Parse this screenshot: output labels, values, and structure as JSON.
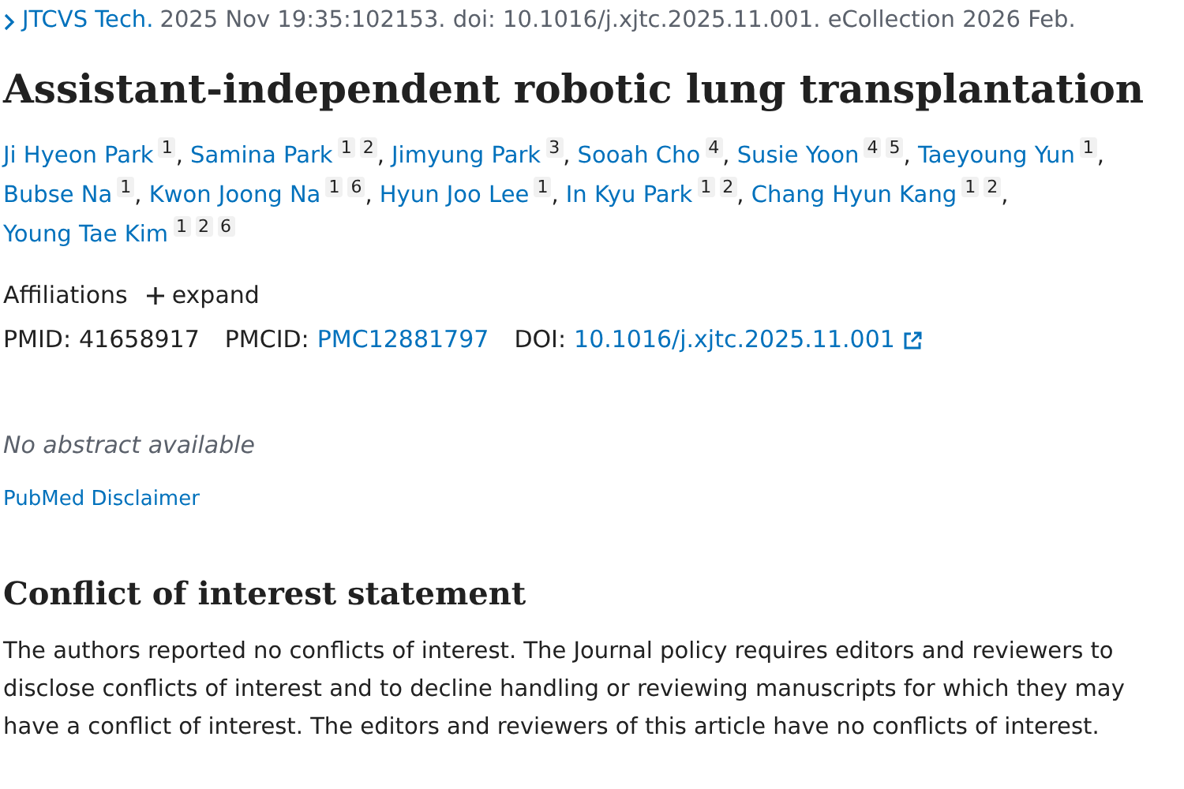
{
  "citation": {
    "journal": "JTCVS Tech.",
    "details": "2025 Nov 19:35:102153. doi: 10.1016/j.xjtc.2025.11.001. eCollection 2026 Feb."
  },
  "title": "Assistant-independent robotic lung transplantation",
  "authors": [
    {
      "name": "Ji Hyeon Park",
      "affiliations": [
        "1"
      ],
      "separator": ","
    },
    {
      "name": "Samina Park",
      "affiliations": [
        "1",
        "2"
      ],
      "separator": ","
    },
    {
      "name": "Jimyung Park",
      "affiliations": [
        "3"
      ],
      "separator": ","
    },
    {
      "name": "Sooah Cho",
      "affiliations": [
        "4"
      ],
      "separator": ","
    },
    {
      "name": "Susie Yoon",
      "affiliations": [
        "4",
        "5"
      ],
      "separator": ","
    },
    {
      "name": "Taeyoung Yun",
      "affiliations": [
        "1"
      ],
      "separator": ","
    },
    {
      "name": "Bubse Na",
      "affiliations": [
        "1"
      ],
      "separator": ","
    },
    {
      "name": "Kwon Joong Na",
      "affiliations": [
        "1",
        "6"
      ],
      "separator": ","
    },
    {
      "name": "Hyun Joo Lee",
      "affiliations": [
        "1"
      ],
      "separator": ","
    },
    {
      "name": "In Kyu Park",
      "affiliations": [
        "1",
        "2"
      ],
      "separator": ","
    },
    {
      "name": "Chang Hyun Kang",
      "affiliations": [
        "1",
        "2"
      ],
      "separator": ","
    },
    {
      "name": "Young Tae Kim",
      "affiliations": [
        "1",
        "2",
        "6"
      ]
    }
  ],
  "affiliations": {
    "label": "Affiliations",
    "toggle": "expand",
    "expanded": false
  },
  "identifiers": [
    {
      "label": "PMID:",
      "value": "41658917",
      "link": false,
      "external": false
    },
    {
      "label": "PMCID:",
      "value": "PMC12881797",
      "link": true,
      "external": false
    },
    {
      "label": "DOI:",
      "value": "10.1016/j.xjtc.2025.11.001",
      "link": true,
      "external": true
    }
  ],
  "abstract_note": "No abstract available",
  "disclaimer_link": "PubMed Disclaimer",
  "section": {
    "heading": "Conflict of interest statement",
    "body": "The authors reported no conflicts of interest. The Journal policy requires editors and reviewers to disclose conflicts of interest and to decline handling or reviewing manuscripts for which they may have a conflict of interest. The editors and reviewers of this article have no conflicts of interest."
  }
}
